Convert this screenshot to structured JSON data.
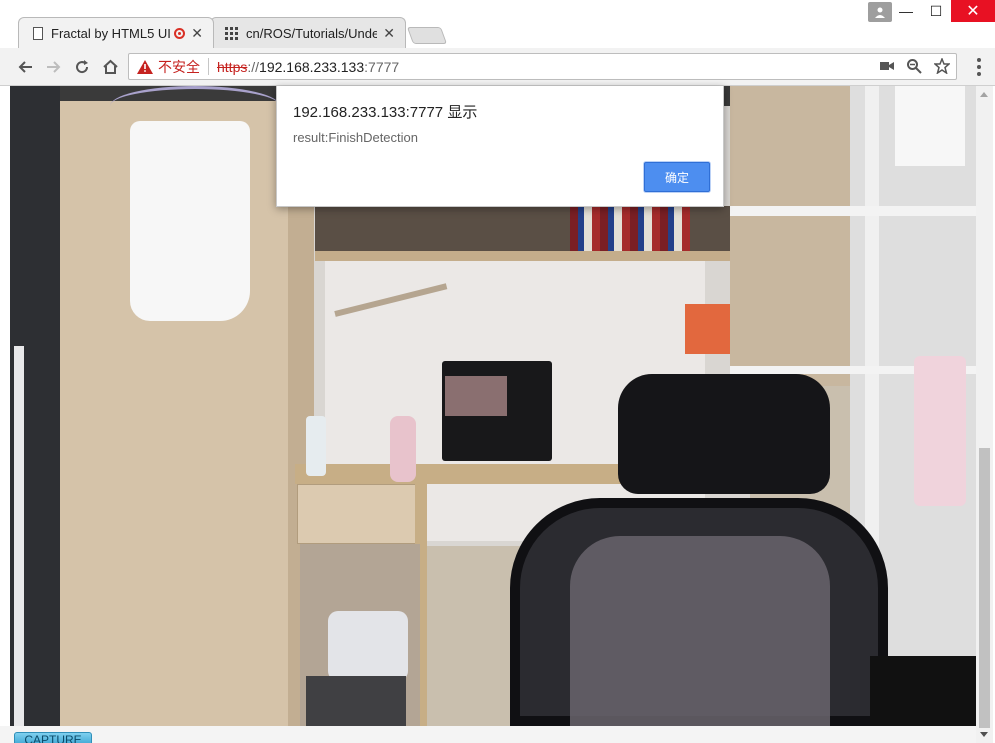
{
  "browser": {
    "tabs": [
      {
        "title": "Fractal by HTML5 UI",
        "active": true,
        "recording": true
      },
      {
        "title": "cn/ROS/Tutorials/Unde",
        "active": false,
        "recording": false
      }
    ],
    "address": {
      "security_label": "不安全",
      "scheme": "https",
      "scheme_sep": "://",
      "host": "192.168.233.133",
      "port": ":7777"
    },
    "window_controls": {
      "minimize": "—",
      "maximize": "☐",
      "close": "✕"
    }
  },
  "dialog": {
    "title": "192.168.233.133:7777 显示",
    "message": "result:FinishDetection",
    "ok_label": "确定",
    "ok_color": "#4d8ef0"
  },
  "page": {
    "capture_label": "CAPTURE"
  },
  "icons": {
    "back": "arrow-left",
    "forward": "arrow-right",
    "reload": "reload",
    "home": "home",
    "camera": "camera",
    "zoom": "magnifier",
    "star": "star",
    "menu": "kebab"
  }
}
